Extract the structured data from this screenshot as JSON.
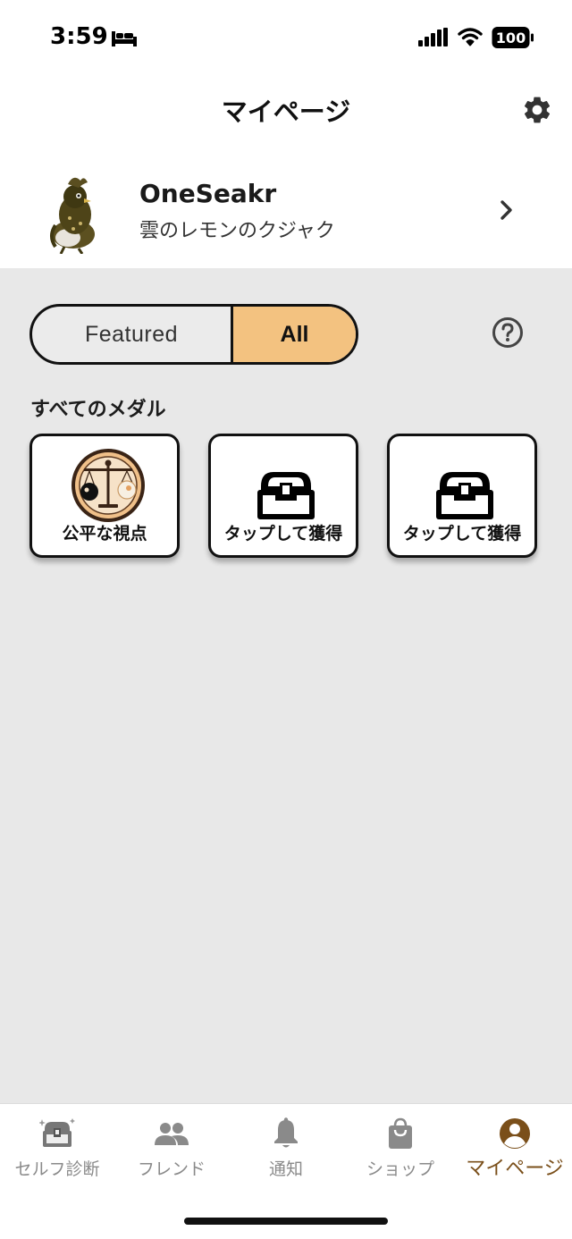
{
  "status_bar": {
    "time": "3:59",
    "battery": "100"
  },
  "header": {
    "title": "マイページ"
  },
  "profile": {
    "name": "OneSeakr",
    "subtitle": "雲のレモンのクジャク"
  },
  "toggle": {
    "options": [
      "Featured",
      "All"
    ],
    "selected": "All"
  },
  "section_title": "すべてのメダル",
  "medals": [
    {
      "label": "公平な視点",
      "icon": "scales-medal-icon"
    },
    {
      "label": "タップして獲得",
      "icon": "treasure-chest-icon"
    },
    {
      "label": "タップして獲得",
      "icon": "treasure-chest-icon"
    }
  ],
  "bottom_nav": {
    "items": [
      {
        "label": "セルフ診断",
        "icon": "treasure-box-icon"
      },
      {
        "label": "フレンド",
        "icon": "friends-icon"
      },
      {
        "label": "通知",
        "icon": "bell-icon"
      },
      {
        "label": "ショップ",
        "icon": "shopping-bag-icon"
      },
      {
        "label": "マイページ",
        "icon": "account-icon",
        "active": true
      }
    ]
  },
  "colors": {
    "accent": "#f3c280",
    "active_nav": "#7a4f1a",
    "background": "#e8e8e8"
  }
}
